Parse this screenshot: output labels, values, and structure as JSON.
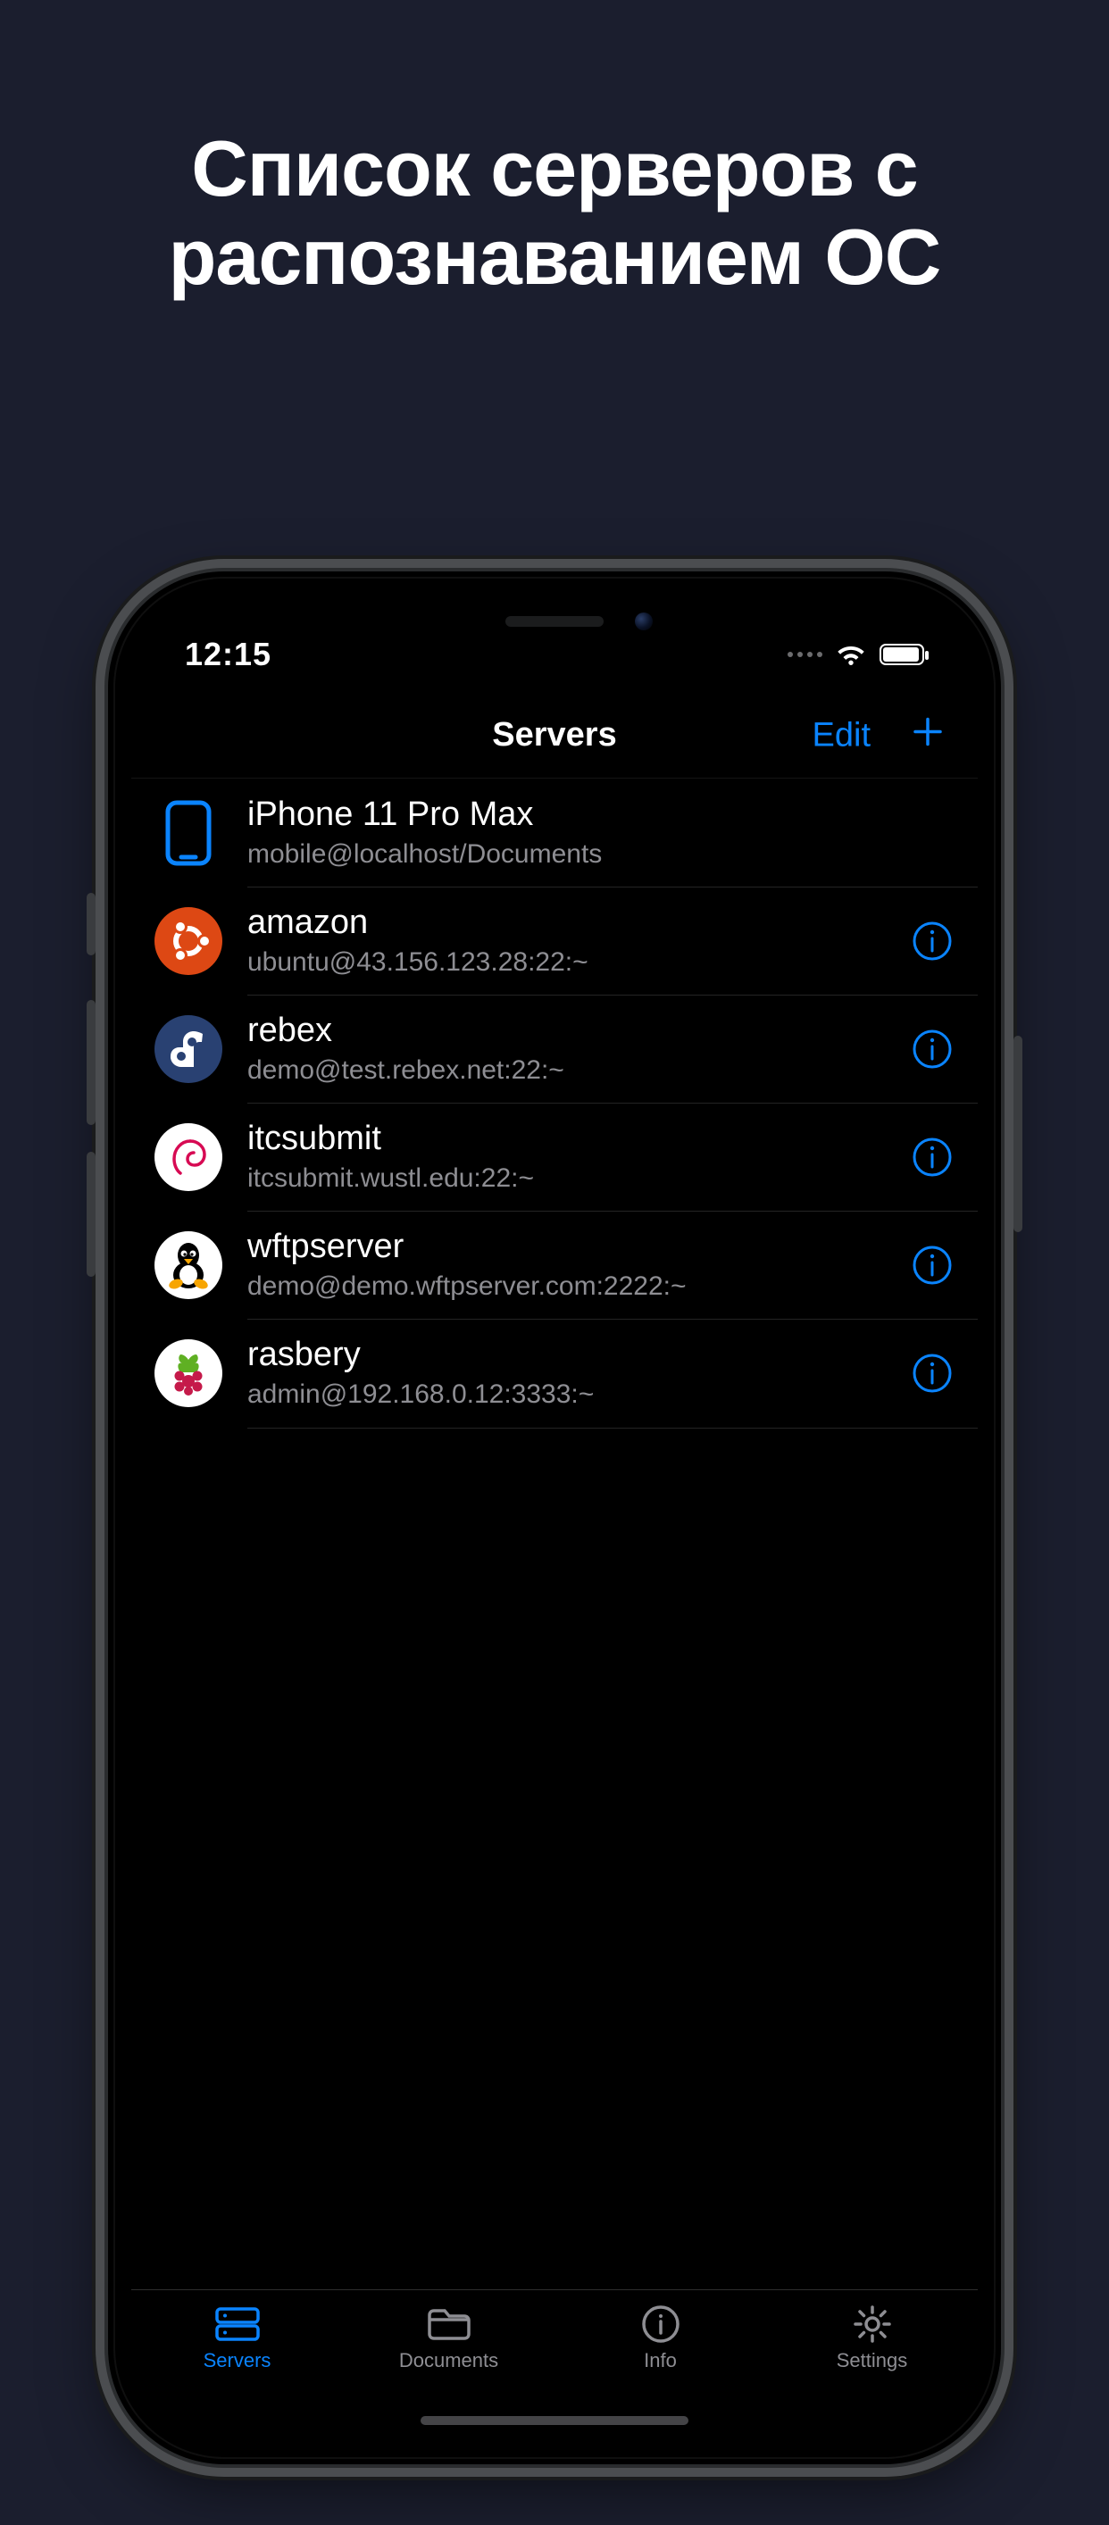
{
  "headline": "Список серверов с распознаванием ОС",
  "status": {
    "time": "12:15"
  },
  "nav": {
    "title": "Servers",
    "edit": "Edit"
  },
  "servers": [
    {
      "name": "iPhone 11 Pro Max",
      "detail": "mobile@localhost/Documents",
      "os": "ios",
      "local": true
    },
    {
      "name": "amazon",
      "detail": "ubuntu@43.156.123.28:22:~",
      "os": "ubuntu"
    },
    {
      "name": "rebex",
      "detail": "demo@test.rebex.net:22:~",
      "os": "fedora"
    },
    {
      "name": "itcsubmit",
      "detail": "itcsubmit.wustl.edu:22:~",
      "os": "debian"
    },
    {
      "name": "wftpserver",
      "detail": "demo@demo.wftpserver.com:2222:~",
      "os": "linux"
    },
    {
      "name": "rasbery",
      "detail": "admin@192.168.0.12:3333:~",
      "os": "raspberry"
    }
  ],
  "tabs": [
    {
      "id": "servers",
      "label": "Servers",
      "active": true
    },
    {
      "id": "documents",
      "label": "Documents",
      "active": false
    },
    {
      "id": "info",
      "label": "Info",
      "active": false
    },
    {
      "id": "settings",
      "label": "Settings",
      "active": false
    }
  ],
  "colors": {
    "accent": "#0a84ff"
  }
}
